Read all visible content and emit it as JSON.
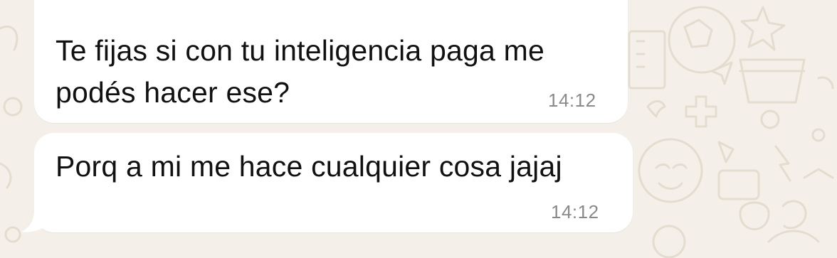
{
  "chat": {
    "messages": [
      {
        "line1": "Te fijas si con tu inteligencia paga me",
        "line2": "podés hacer ese?",
        "time": "14:12",
        "has_quoted_reply": true
      },
      {
        "line1": "Porq a mi me hace cualquier cosa jajaj",
        "time": "14:12"
      }
    ]
  },
  "colors": {
    "background": "#f4f0e9",
    "bubble": "#ffffff",
    "quote_accent": "#e0417e",
    "timestamp": "#8a8a8a"
  },
  "icons": [
    "wallpaper-doodles"
  ]
}
